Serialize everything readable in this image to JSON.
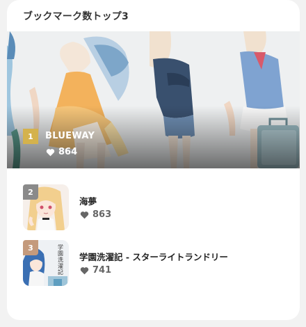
{
  "card": {
    "title": "ブックマーク数トップ3"
  },
  "colors": {
    "gold": "#d4b24c",
    "silver": "#8a8a8a",
    "bronze": "#c49a7c",
    "like_icon": "#666666"
  },
  "top": {
    "rank": "1",
    "title": "BLUEWAY",
    "likes": "864",
    "heart_icon": "heart-icon"
  },
  "items": [
    {
      "rank": "2",
      "title": "海夢",
      "likes": "863",
      "heart_icon": "heart-icon"
    },
    {
      "rank": "3",
      "title": "学園洗濯記 - スターライトランドリー",
      "likes": "741",
      "heart_icon": "heart-icon",
      "thumb_text": "学園洗濯記"
    }
  ]
}
